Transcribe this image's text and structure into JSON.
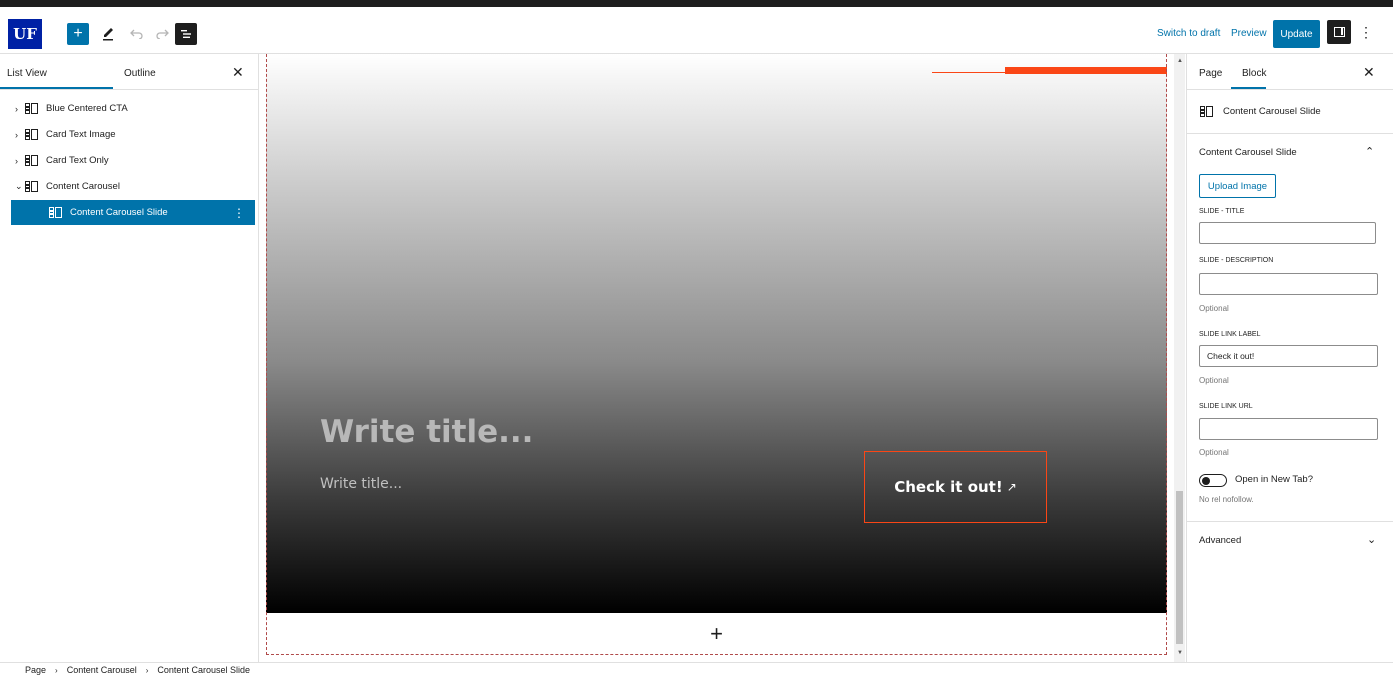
{
  "toolbar": {
    "logo_text": "UF",
    "add_label": "+",
    "switch_to_draft": "Switch to draft",
    "preview": "Preview",
    "update": "Update",
    "more": "⋮"
  },
  "left_panel": {
    "tabs": [
      {
        "label": "List View",
        "active": true
      },
      {
        "label": "Outline",
        "active": false
      }
    ],
    "close": "✕",
    "tree": [
      {
        "label": "Blue Centered CTA",
        "expanded": false,
        "chev": "›"
      },
      {
        "label": "Card Text Image",
        "expanded": false,
        "chev": "›"
      },
      {
        "label": "Card Text Only",
        "expanded": false,
        "chev": "›"
      },
      {
        "label": "Content Carousel",
        "expanded": true,
        "chev": "⌄"
      },
      {
        "label": "Content Carousel Slide",
        "selected": true,
        "dots": "⋮"
      }
    ]
  },
  "canvas": {
    "title_placeholder": "Write title...",
    "description_placeholder": "Write title...",
    "cta_label": "Check it out!",
    "cta_ext_icon": "↗",
    "add_block": "+",
    "accent_color": "#fa4616"
  },
  "right_panel": {
    "tabs": [
      {
        "label": "Page",
        "active": false
      },
      {
        "label": "Block",
        "active": true
      }
    ],
    "close": "✕",
    "block_name": "Content Carousel Slide",
    "section_title": "Content Carousel Slide",
    "section_chev": "⌃",
    "upload_image": "Upload Image",
    "fields": {
      "slide_title": {
        "label": "SLIDE - TITLE",
        "value": ""
      },
      "slide_description": {
        "label": "SLIDE - DESCRIPTION",
        "value": "",
        "help": "Optional"
      },
      "slide_link_label": {
        "label": "SLIDE LINK LABEL",
        "value": "Check it out!",
        "help": "Optional"
      },
      "slide_link_url": {
        "label": "SLIDE LINK URL",
        "value": "",
        "help": "Optional"
      }
    },
    "toggle_label": "Open in New Tab?",
    "toggle_help": "No rel nofollow.",
    "advanced": "Advanced",
    "advanced_chev": "⌄"
  },
  "breadcrumb": [
    "Page",
    "Content Carousel",
    "Content Carousel Slide"
  ],
  "colors": {
    "primary": "#0073aa",
    "brand": "#0021a5",
    "accent": "#fa4616"
  }
}
